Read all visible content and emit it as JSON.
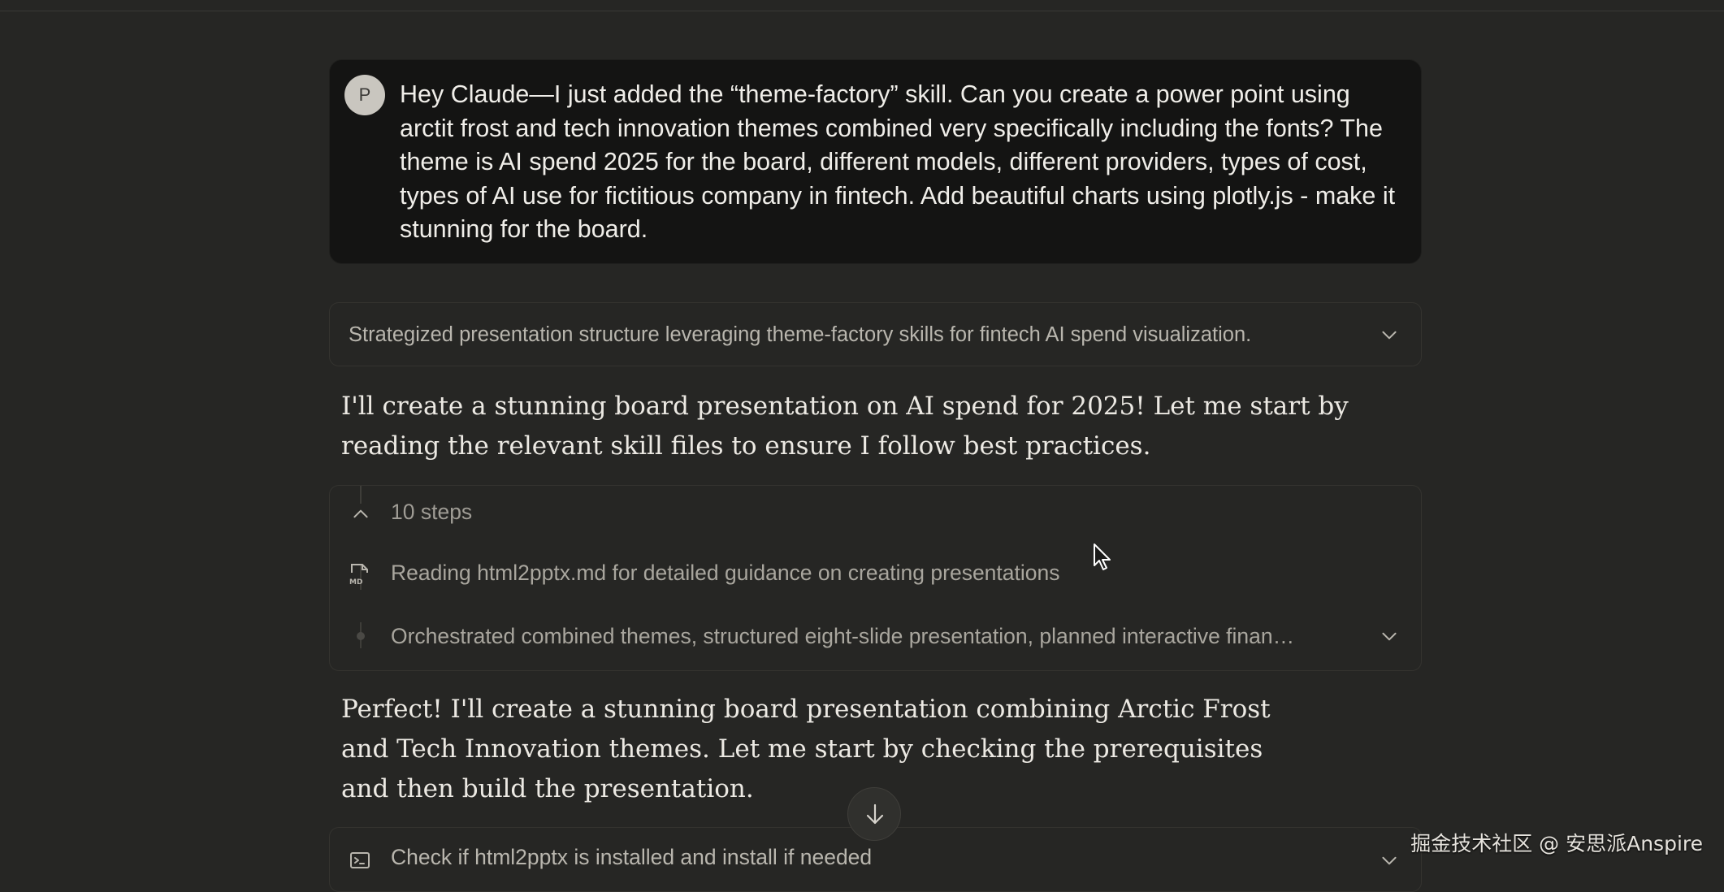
{
  "user_message": {
    "avatar_initial": "P",
    "text": "Hey Claude—I just added the “theme-factory” skill. Can you create a power point using arctit frost and tech innovation themes combined very specifically including the fonts? The theme is AI spend 2025 for the board, different models, different providers, types of cost, types of AI use for fictitious company in fintech. Add beautiful charts using plotly.js - make it stunning for the board."
  },
  "thinking_summary": {
    "text": "Strategized presentation structure leveraging theme-factory skills for fintech AI spend visualization.",
    "icon": "chevron-down-icon"
  },
  "assistant_reply_1": "I'll create a stunning board presentation on AI spend for 2025! Let me start by reading the relevant skill files to ensure I follow best practices.",
  "steps_panel": {
    "header": "10 steps",
    "items": [
      {
        "icon": "markdown-file-icon",
        "text": "Reading html2pptx.md for detailed guidance on creating presentations"
      },
      {
        "icon": "dot-icon",
        "text": "Orchestrated combined themes, structured eight-slide presentation, planned interactive finan…"
      }
    ]
  },
  "assistant_reply_2": "Perfect! I'll create a stunning board presentation combining Arctic Frost and Tech Innovation themes. Let me start by checking the prerequisites and then build the presentation.",
  "tool_call": {
    "icon": "terminal-icon",
    "text": "Check if html2pptx is installed and install if needed"
  },
  "scroll_button_icon": "arrow-down-icon",
  "watermark": "掘金技术社区 @ 安思派Anspire"
}
